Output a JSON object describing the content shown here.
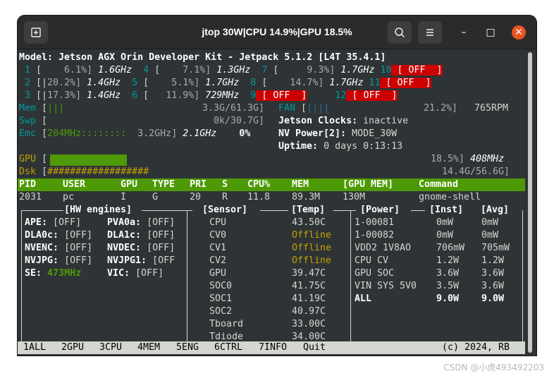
{
  "window": {
    "title": "jtop 30W|CPU 14.9%|GPU 18.5%"
  },
  "lines": {
    "model": "Model: Jetson AGX Orin Developer Kit - Jetpack 5.1.2 [L4T 35.4.1]",
    "cpu": [
      {
        "n": " 1",
        "bar": " [   ",
        "pct": " 6.1%]",
        "freq": " 1.6GHz"
      },
      {
        "n": " 2",
        "bar": " [|",
        "pct": "20.2%]",
        "freq": " 1.4GHz"
      },
      {
        "n": " 3",
        "bar": " [|",
        "pct": "17.3%]",
        "freq": " 1.4GHz"
      },
      {
        "n": " 4",
        "bar": " [   ",
        "pct": " 7.1%]",
        "freq": " 1.3GHz"
      },
      {
        "n": " 5",
        "bar": " [   ",
        "pct": " 5.1%]",
        "freq": " 1.7GHz"
      },
      {
        "n": " 6",
        "bar": " [   ",
        "pct": "11.9%]",
        "freq": " 729MHz"
      },
      {
        "n": " 7",
        "bar": " [   ",
        "pct": "  9.3%]",
        "freq": " 1.7GHz"
      },
      {
        "n": " 8",
        "bar": " [   ",
        "pct": " 14.7%]",
        "freq": " 1.7GHz"
      },
      {
        "n": " 9",
        "off": " [ OFF  ]"
      },
      {
        "n": "10",
        "off": " [ OFF  ]"
      },
      {
        "n": "11",
        "off": " [ OFF  ]"
      },
      {
        "n": "12",
        "off": " [ OFF  ]"
      }
    ],
    "mem_label": "Mem",
    "mem_bar": "|||",
    "mem_val": "3.3G/61.3G]",
    "fan_label": "FAN",
    "fan_bar": "||||",
    "fan_val": "21.2%]",
    "fan_rpm": "765RPM",
    "swp_label": "Swp",
    "swp_val": "0k/30.7G]",
    "clocks_label": "Jetson Clocks:",
    "clocks_val": "inactive",
    "emc_label": "Emc",
    "emc_bar": "204MHz::::::::",
    "emc_max": "3.2GHz]",
    "emc_cur": "2.1GHz",
    "emc_pct": "0%",
    "nvp_label": "NV Power[2]:",
    "nvp_val": "MODE_30W",
    "uptime_label": "Uptime:",
    "uptime_val": "0 days 0:13:13",
    "gpu_label": "GPU",
    "gpu_pct": "18.5%]",
    "gpu_freq": "408MHz",
    "dsk_label": "Dsk",
    "dsk_bar": "##################",
    "dsk_val": "14.4G/56.6G]"
  },
  "proc_header": [
    "PID",
    "USER",
    "GPU",
    "TYPE",
    "PRI",
    "S",
    "CPU%",
    "MEM",
    "[GPU MEM]",
    "Command"
  ],
  "proc_rows": [
    [
      "2031",
      "pc",
      "I",
      "G",
      "20",
      "R",
      "11.8",
      "89.3M",
      "130M",
      "gnome-shell"
    ]
  ],
  "panels": {
    "hw_title": "[HW engines]",
    "hw": [
      [
        {
          "k": "APE:",
          "v": "[OFF]"
        },
        {
          "k": "PVA0a:",
          "v": "[OFF]"
        }
      ],
      [
        {
          "k": "DLA0c:",
          "v": "[OFF]"
        },
        {
          "k": "DLA1c:",
          "v": "[OFF]"
        }
      ],
      [
        {
          "k": "NVENC:",
          "v": "[OFF]"
        },
        {
          "k": "NVDEC:",
          "v": "[OFF]"
        }
      ],
      [
        {
          "k": "NVJPG:",
          "v": "[OFF]"
        },
        {
          "k": "NVJPG1:",
          "v": "[OFF"
        }
      ],
      [
        {
          "k": "SE:",
          "v": "473MHz"
        },
        {
          "k": "VIC:",
          "v": "[OFF]"
        }
      ]
    ],
    "sensor_title": "[Sensor]",
    "temp_title": "[Temp]",
    "sensors": [
      {
        "name": "CPU",
        "temp": "43.50C"
      },
      {
        "name": "CV0",
        "temp": "Offline"
      },
      {
        "name": "CV1",
        "temp": "Offline"
      },
      {
        "name": "CV2",
        "temp": "Offline"
      },
      {
        "name": "GPU",
        "temp": "39.47C"
      },
      {
        "name": "SOC0",
        "temp": "41.75C"
      },
      {
        "name": "SOC1",
        "temp": "41.19C"
      },
      {
        "name": "SOC2",
        "temp": "40.97C"
      },
      {
        "name": "Tboard",
        "temp": "33.00C"
      },
      {
        "name": "Tdiode",
        "temp": "34.00C"
      }
    ],
    "power_title": "[Power]",
    "inst_title": "[Inst]",
    "avg_title": "[Avg]",
    "power": [
      {
        "name": "1-00081",
        "inst": "0mW",
        "avg": "0mW"
      },
      {
        "name": "1-00082",
        "inst": "0mW",
        "avg": "0mW"
      },
      {
        "name": "VDD2 1V8AO",
        "inst": "706mW",
        "avg": "705mW"
      },
      {
        "name": "CPU CV",
        "inst": "1.2W",
        "avg": "1.2W"
      },
      {
        "name": "GPU SOC",
        "inst": "3.6W",
        "avg": "3.6W"
      },
      {
        "name": "VIN SYS 5V0",
        "inst": "3.5W",
        "avg": "3.6W"
      },
      {
        "name": "ALL",
        "inst": "9.0W",
        "avg": "9.0W"
      }
    ]
  },
  "footer": {
    "tabs": [
      {
        "num": "1",
        "label": "ALL"
      },
      {
        "num": "2",
        "label": "GPU"
      },
      {
        "num": "3",
        "label": "CPU"
      },
      {
        "num": "4",
        "label": "MEM"
      },
      {
        "num": "5",
        "label": "ENG"
      },
      {
        "num": "6",
        "label": "CTRL"
      },
      {
        "num": "7",
        "label": "INFO"
      }
    ],
    "quit": "Quit",
    "copyright": "(c) 2024, RB"
  },
  "watermark": "CSDN @小虎493492203"
}
